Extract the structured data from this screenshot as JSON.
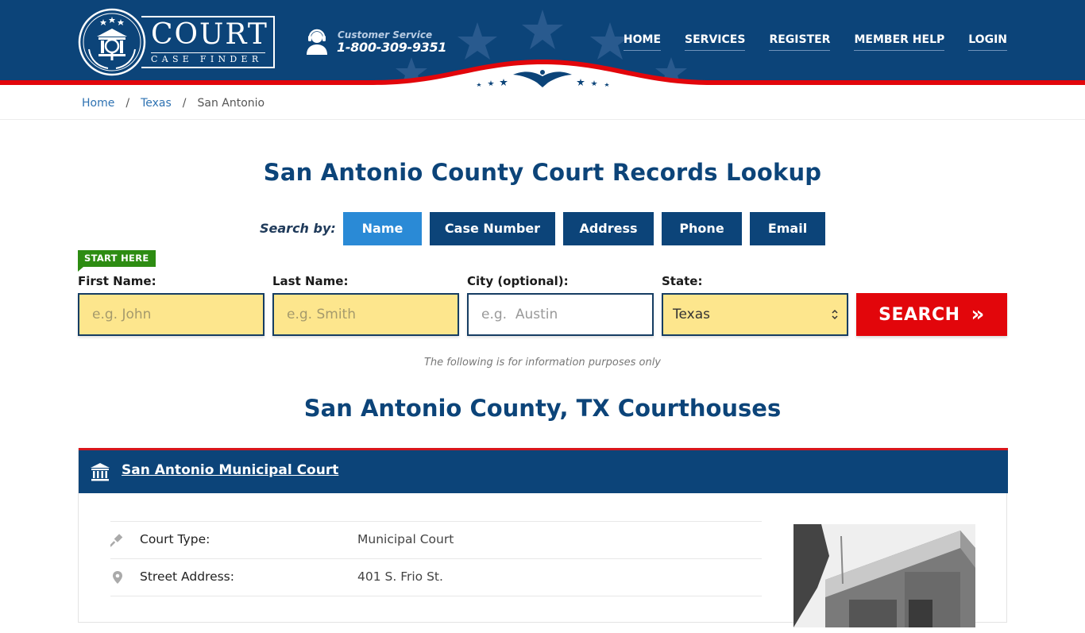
{
  "header": {
    "logo": {
      "title": "COURT",
      "subtitle": "CASE FINDER"
    },
    "customer_service": {
      "label": "Customer Service",
      "phone": "1-800-309-9351"
    },
    "nav": [
      {
        "label": "HOME"
      },
      {
        "label": "SERVICES"
      },
      {
        "label": "REGISTER"
      },
      {
        "label": "MEMBER HELP"
      },
      {
        "label": "LOGIN"
      }
    ]
  },
  "breadcrumb": [
    {
      "label": "Home"
    },
    {
      "label": "Texas"
    },
    {
      "label": "San Antonio"
    }
  ],
  "page_title": "San Antonio County Court Records Lookup",
  "search": {
    "search_by_label": "Search by:",
    "tabs": [
      {
        "label": "Name",
        "active": true
      },
      {
        "label": "Case Number",
        "active": false
      },
      {
        "label": "Address",
        "active": false
      },
      {
        "label": "Phone",
        "active": false
      },
      {
        "label": "Email",
        "active": false
      }
    ],
    "start_here": "START HERE",
    "fields": {
      "first_name": {
        "label": "First Name:",
        "placeholder": "e.g. John",
        "value": ""
      },
      "last_name": {
        "label": "Last Name:",
        "placeholder": "e.g. Smith",
        "value": ""
      },
      "city": {
        "label": "City (optional):",
        "placeholder": "e.g.  Austin",
        "value": ""
      },
      "state": {
        "label": "State:",
        "selected": "Texas"
      }
    },
    "button_label": "SEARCH",
    "button_icon": "»"
  },
  "note": "The following is for information purposes only",
  "courthouses_title": "San Antonio County, TX Courthouses",
  "courthouse": {
    "name": "San Antonio Municipal Court",
    "details": [
      {
        "icon": "gavel-icon",
        "label": "Court Type:",
        "value": "Municipal Court"
      },
      {
        "icon": "map-pin-icon",
        "label": "Street Address:",
        "value": "401 S. Frio St."
      }
    ]
  },
  "colors": {
    "primary_blue": "#0c4479",
    "active_tab": "#2a8ad6",
    "search_red": "#e2060b",
    "start_green": "#2d8c12",
    "input_yellow": "#fde68d"
  }
}
